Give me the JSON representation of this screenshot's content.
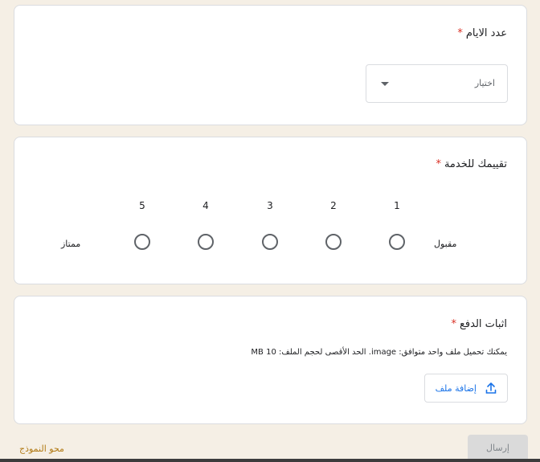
{
  "questions": {
    "days": {
      "title": "عدد الايام",
      "required_mark": "*",
      "select_placeholder": "اختيار"
    },
    "rating": {
      "title": "تقييمك للخدمة",
      "required_mark": "*",
      "scale": [
        "1",
        "2",
        "3",
        "4",
        "5"
      ],
      "low_label": "مقبول",
      "high_label": "ممتاز"
    },
    "payment": {
      "title": "اثبات الدفع",
      "required_mark": "*",
      "hint": "يمكنك تحميل ملف واحد متوافق: image. الحد الأقصى لحجم الملف: 10 MB",
      "upload_label": "إضافة ملف"
    }
  },
  "footer": {
    "clear_label": "محو النموذج",
    "submit_label": "إرسال"
  }
}
